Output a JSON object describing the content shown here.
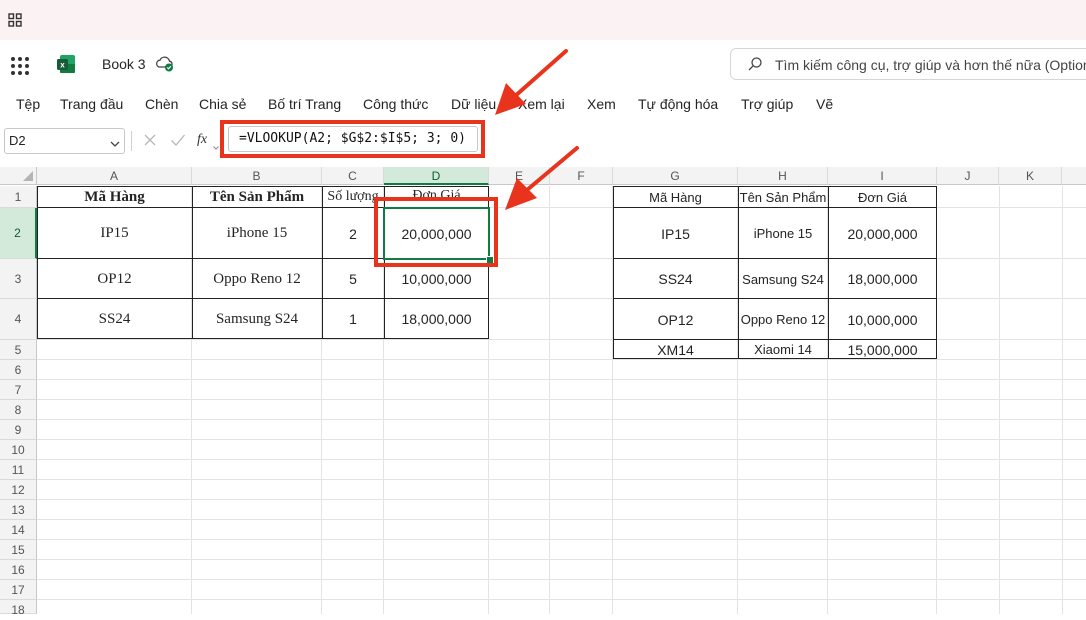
{
  "app": {
    "document_title": "Book 3"
  },
  "search": {
    "placeholder": "Tìm kiếm công cụ, trợ giúp và hơn thế nữa (Option"
  },
  "menu": [
    "Tệp",
    "Trang đầu",
    "Chèn",
    "Chia sẻ",
    "Bố trí Trang",
    "Công thức",
    "Dữ liệu",
    "Xem lại",
    "Xem",
    "Tự động hóa",
    "Trợ giúp",
    "Vẽ"
  ],
  "formula_bar": {
    "name_box": "D2",
    "fx_label": "fx",
    "formula": "=VLOOKUP(A2; $G$2:$I$5; 3; 0)"
  },
  "columns": [
    "A",
    "B",
    "C",
    "D",
    "E",
    "F",
    "G",
    "H",
    "I",
    "J",
    "K"
  ],
  "rows": [
    "1",
    "2",
    "3",
    "4",
    "5",
    "6",
    "7",
    "8",
    "9",
    "10",
    "11",
    "12",
    "13",
    "14",
    "15",
    "16",
    "17",
    "18"
  ],
  "table1": {
    "headers": [
      "Mã Hàng",
      "Tên Sản Phẩm",
      "Số lượng",
      "Đơn Giá"
    ],
    "rows": [
      [
        "IP15",
        "iPhone 15",
        "2",
        "20,000,000"
      ],
      [
        "OP12",
        "Oppo Reno 12",
        "5",
        "10,000,000"
      ],
      [
        "SS24",
        "Samsung S24",
        "1",
        "18,000,000"
      ]
    ]
  },
  "table2": {
    "headers": [
      "Mã Hàng",
      "Tên Sản Phẩm",
      "Đơn Giá"
    ],
    "rows": [
      [
        "IP15",
        "iPhone 15",
        "20,000,000"
      ],
      [
        "SS24",
        "Samsung S24",
        "18,000,000"
      ],
      [
        "OP12",
        "Oppo Reno 12",
        "10,000,000"
      ],
      [
        "XM14",
        "Xiaomi 14",
        "15,000,000"
      ]
    ]
  },
  "colors": {
    "annotation_red": "#e8341c",
    "selection_green": "#107c41",
    "excel_green": "#1f7244"
  }
}
